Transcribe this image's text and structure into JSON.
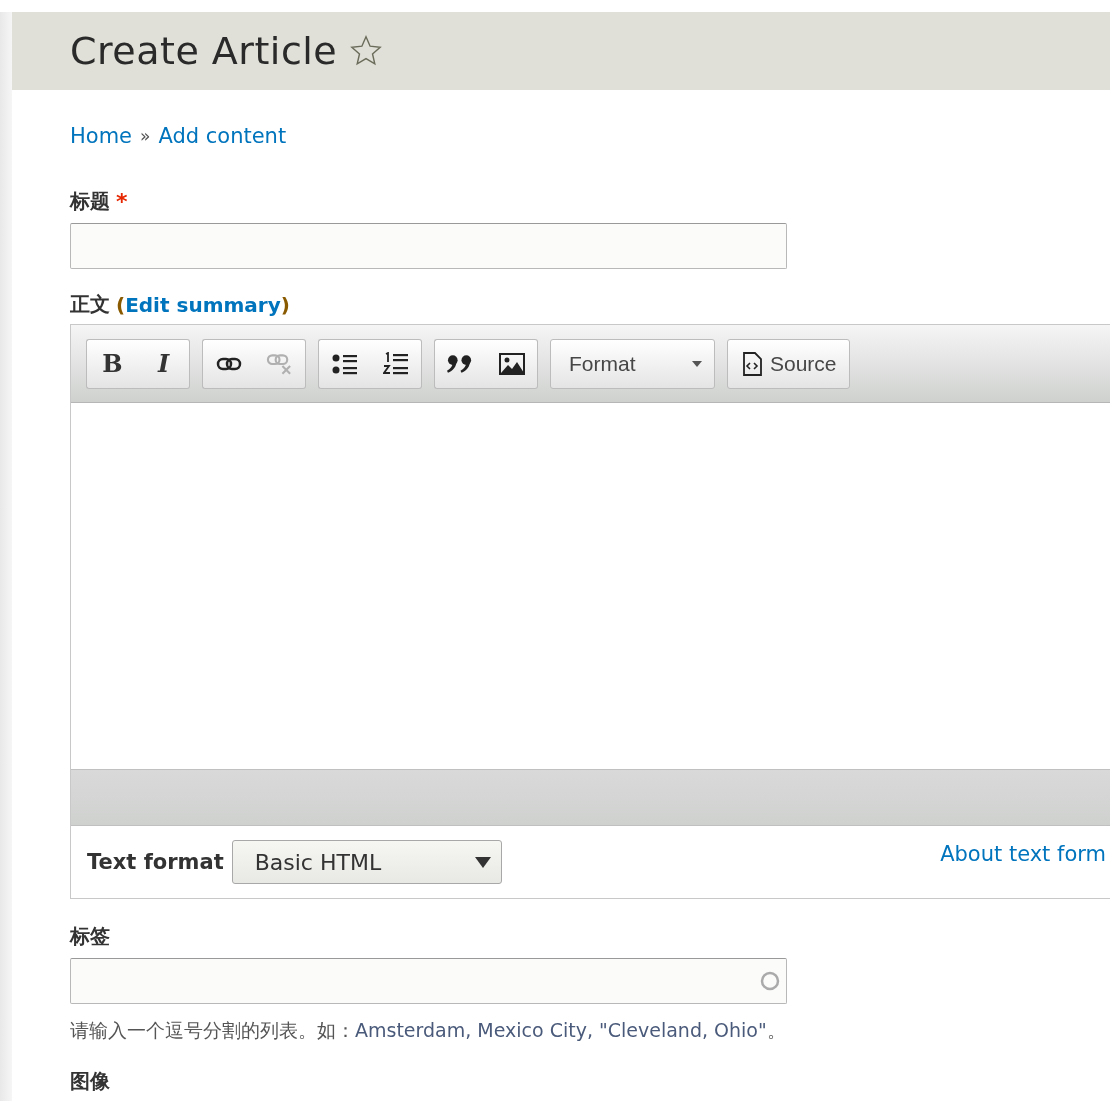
{
  "header": {
    "title": "Create Article",
    "starred": false
  },
  "breadcrumb": [
    {
      "label": "Home"
    },
    {
      "label": "Add content"
    }
  ],
  "breadcrumb_separator": "»",
  "title_field": {
    "label": "标题",
    "required_mark": "*"
  },
  "body": {
    "label": "正文",
    "link_open": "(",
    "link": "Edit summary",
    "link_close": ")"
  },
  "toolbar": [
    {
      "buttons": [
        {
          "kind": "bold",
          "label": "B",
          "disabled": false
        },
        {
          "kind": "italic",
          "label": "I",
          "disabled": false
        }
      ]
    },
    {
      "buttons": [
        {
          "kind": "link",
          "disabled": false
        },
        {
          "kind": "unlink",
          "disabled": true
        }
      ]
    },
    {
      "buttons": [
        {
          "kind": "bullets",
          "disabled": false
        },
        {
          "kind": "numbers",
          "disabled": false
        }
      ]
    },
    {
      "buttons": [
        {
          "kind": "quote",
          "disabled": false
        },
        {
          "kind": "image",
          "disabled": false
        }
      ]
    },
    {
      "buttons": [
        {
          "kind": "dropdown",
          "label": "Format",
          "disabled": false
        }
      ]
    },
    {
      "buttons": [
        {
          "kind": "source",
          "label": "Source",
          "disabled": false
        }
      ]
    }
  ],
  "text_format": {
    "label": "Text format",
    "value": "Basic HTML",
    "about_link": "About text form"
  },
  "tags_field": {
    "label": "标签",
    "help_prefix": "请输入一个逗号分割的列表。如：",
    "help_example": "Amsterdam, Mexico City, \"Cleveland, Ohio\"",
    "help_suffix": "。"
  },
  "image_field": {
    "label": "图像"
  }
}
